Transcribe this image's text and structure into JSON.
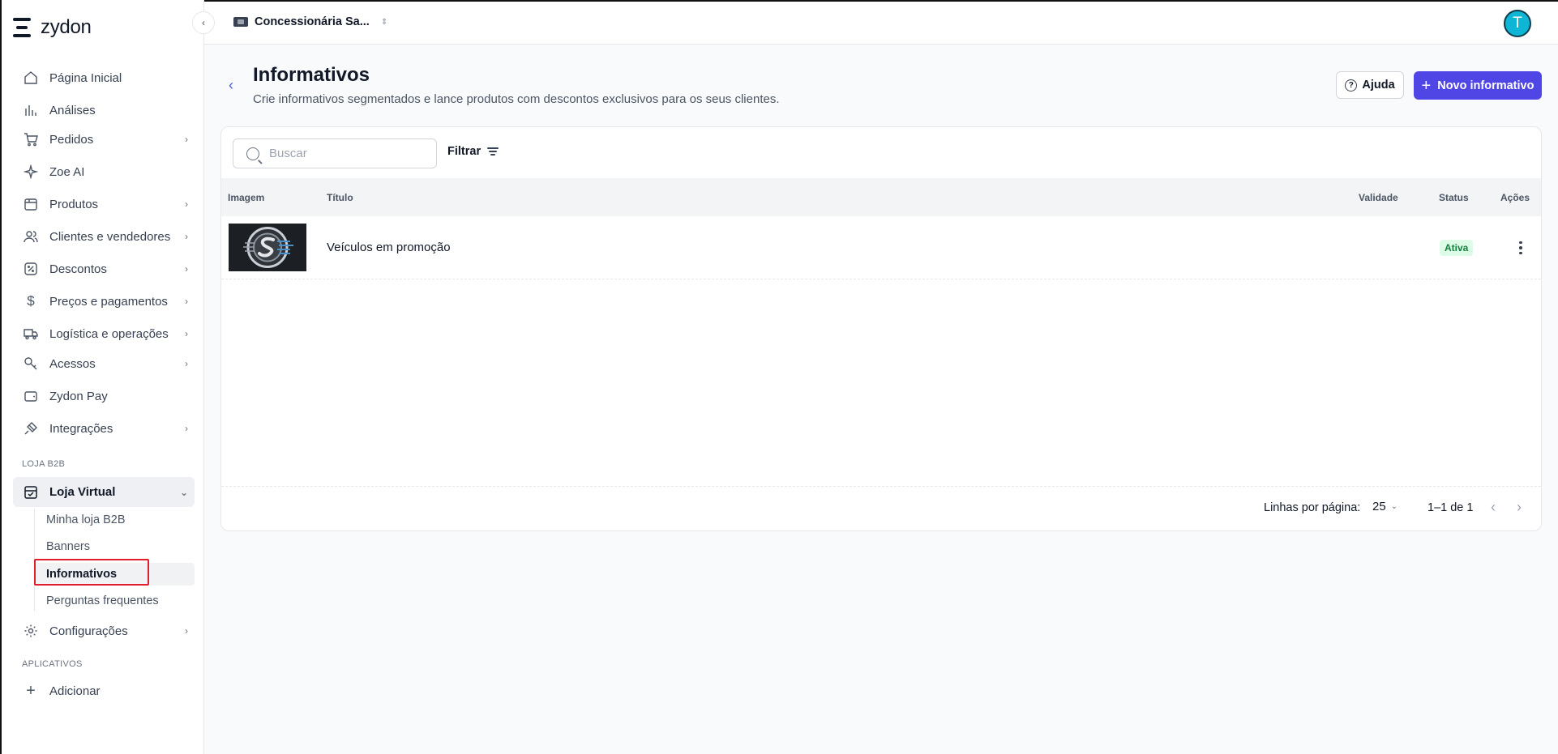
{
  "app": {
    "logo_text": "zydon"
  },
  "topbar": {
    "store_name": "Concessionária Sa...",
    "avatar_initial": "T"
  },
  "sidebar": {
    "items": [
      {
        "label": "Página Inicial"
      },
      {
        "label": "Análises"
      },
      {
        "label": "Pedidos"
      },
      {
        "label": "Zoe AI"
      },
      {
        "label": "Produtos"
      },
      {
        "label": "Clientes e vendedores"
      },
      {
        "label": "Descontos"
      },
      {
        "label": "Preços e pagamentos"
      },
      {
        "label": "Logística e operações"
      },
      {
        "label": "Acessos"
      },
      {
        "label": "Zydon Pay"
      },
      {
        "label": "Integrações"
      }
    ],
    "section_b2b": "LOJA B2B",
    "loja_virtual": "Loja Virtual",
    "sub_items": [
      {
        "label": "Minha loja B2B"
      },
      {
        "label": "Banners"
      },
      {
        "label": "Informativos"
      },
      {
        "label": "Perguntas frequentes"
      }
    ],
    "configuracoes": "Configurações",
    "section_apps": "APLICATIVOS",
    "adicionar": "Adicionar"
  },
  "header": {
    "title": "Informativos",
    "subtitle": "Crie informativos segmentados e lance produtos com descontos exclusivos para os seus clientes.",
    "help_label": "Ajuda",
    "new_label": "Novo informativo"
  },
  "toolbar": {
    "search_placeholder": "Buscar",
    "filter_label": "Filtrar"
  },
  "table": {
    "columns": {
      "image": "Imagem",
      "title": "Título",
      "validity": "Validade",
      "status": "Status",
      "actions": "Ações"
    },
    "rows": [
      {
        "title": "Veículos em promoção",
        "validity": "",
        "status": "Ativa"
      }
    ]
  },
  "pagination": {
    "rows_per_page_label": "Linhas por página:",
    "rows_per_page": "25",
    "range": "1–1 de 1"
  },
  "colors": {
    "primary": "#4f46e5",
    "status_active_bg": "#dcfce7",
    "status_active_text": "#15803d",
    "highlight": "#e11d2e"
  }
}
